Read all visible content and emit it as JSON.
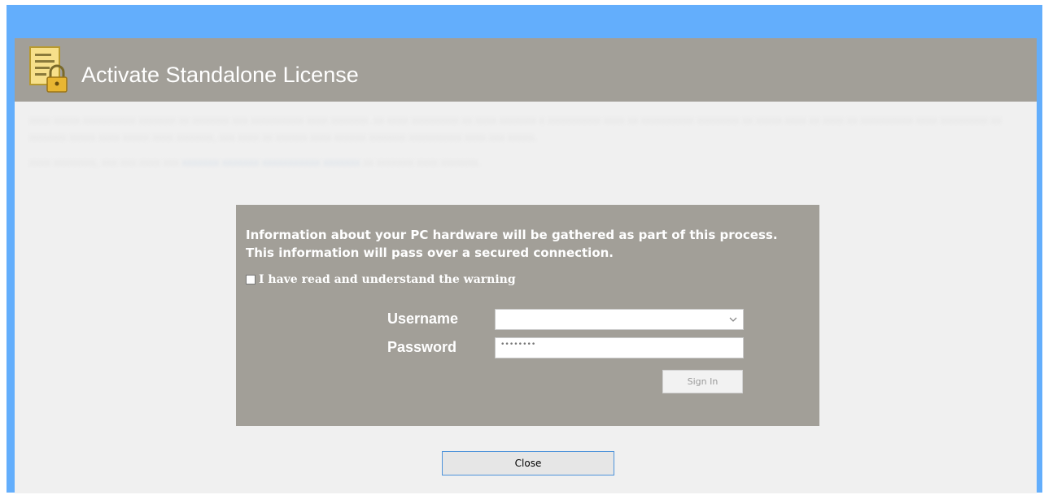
{
  "dialog": {
    "title": "Activate Standalone License"
  },
  "panel": {
    "info_text": "Information about your PC hardware will be gathered as part of this process. This information will pass over a secured connection.",
    "warning_checkbox_label": "I have read and understand the warning",
    "warning_checked": false,
    "username_label": "Username",
    "username_value": "",
    "password_label": "Password",
    "password_value": "••••••••",
    "signin_label": "Sign In"
  },
  "footer": {
    "close_label": "Close"
  },
  "icons": {
    "header": "license-document-lock-icon",
    "username_dropdown": "chevron-down-icon"
  },
  "colors": {
    "window_frame": "#63aefc",
    "header_band": "#a29f98",
    "panel": "#a29f98",
    "client_bg": "#f0f0f0",
    "close_border": "#4e93da"
  }
}
